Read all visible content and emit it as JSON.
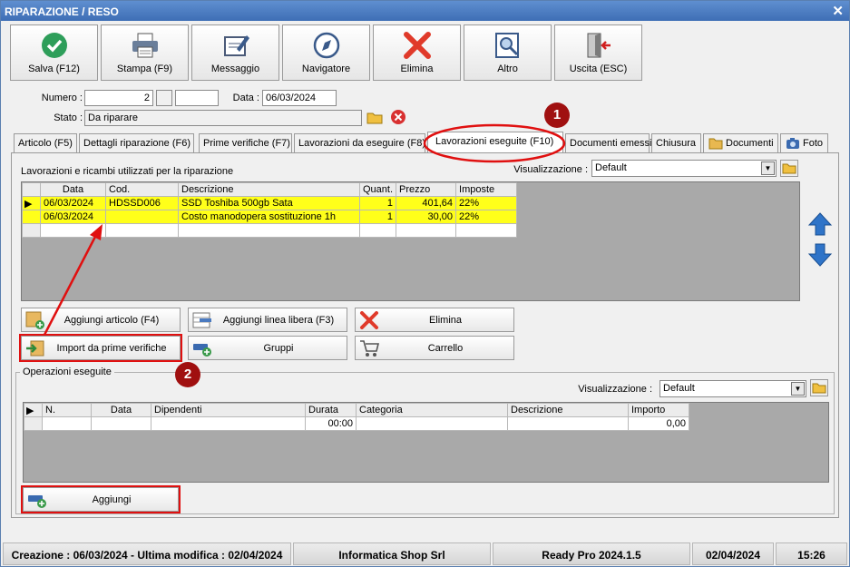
{
  "window": {
    "title": "RIPARAZIONE / RESO",
    "close_glyph": "✕"
  },
  "toolbar": [
    {
      "label": "Salva (F12)",
      "icon": "check-icon"
    },
    {
      "label": "Stampa (F9)",
      "icon": "printer-icon"
    },
    {
      "label": "Messaggio",
      "icon": "message-icon"
    },
    {
      "label": "Navigatore",
      "icon": "compass-icon"
    },
    {
      "label": "Elimina",
      "icon": "delete-x-icon"
    },
    {
      "label": "Altro",
      "icon": "magnifier-icon"
    },
    {
      "label": "Uscita (ESC)",
      "icon": "exit-door-icon"
    }
  ],
  "header": {
    "numero_label": "Numero :",
    "numero_value": "2",
    "data_label": "Data :",
    "data_value": "06/03/2024",
    "stato_label": "Stato :",
    "stato_value": "Da riparare"
  },
  "tabs": [
    {
      "label": "Articolo (F5)"
    },
    {
      "label": "Dettagli riparazione (F6)"
    },
    {
      "label": "Prime verifiche (F7)"
    },
    {
      "label": "Lavorazioni da eseguire (F8)"
    },
    {
      "label": "Lavorazioni eseguite  (F10)"
    },
    {
      "label": "Documenti emessi"
    },
    {
      "label": "Chiusura"
    },
    {
      "label": "Documenti"
    },
    {
      "label": "Foto"
    }
  ],
  "lavorazioni": {
    "section_label": "Lavorazioni e ricambi utilizzati per la riparazione",
    "view_label": "Visualizzazione :",
    "view_value": "Default",
    "columns": [
      "Data",
      "Cod.",
      "Descrizione",
      "Quant.",
      "Prezzo",
      "Imposte"
    ],
    "rows": [
      {
        "data": "06/03/2024",
        "cod": "HDSSD006",
        "descrizione": "SSD Toshiba 500gb Sata",
        "quant": "1",
        "prezzo": "401,64",
        "imposte": "22%"
      },
      {
        "data": "06/03/2024",
        "cod": "",
        "descrizione": "Costo manodopera sostituzione 1h",
        "quant": "1",
        "prezzo": "30,00",
        "imposte": "22%"
      }
    ],
    "buttons": {
      "aggiungi_articolo": "Aggiungi articolo (F4)",
      "aggiungi_linea": "Aggiungi linea libera (F3)",
      "elimina": "Elimina",
      "import_prime": "Import da prime verifiche",
      "gruppi": "Gruppi",
      "carrello": "Carrello"
    }
  },
  "operazioni": {
    "group_label": "Operazioni eseguite",
    "view_label": "Visualizzazione :",
    "view_value": "Default",
    "columns": [
      "N.",
      "Data",
      "Dipendenti",
      "Durata",
      "Categoria",
      "Descrizione",
      "Importo"
    ],
    "row": {
      "n": "",
      "data": "",
      "dipendenti": "",
      "durata": "00:00",
      "categoria": "",
      "descrizione": "",
      "importo": "0,00"
    },
    "aggiungi_label": "Aggiungi"
  },
  "markers": {
    "one": "1",
    "two": "2"
  },
  "statusbar": {
    "dates": "Creazione : 06/03/2024 - Ultima modifica : 02/04/2024",
    "company": "Informatica Shop Srl",
    "product": "Ready Pro 2024.1.5",
    "date": "02/04/2024",
    "time": "15:26"
  },
  "colors": {
    "highlight": "#ffff1a",
    "annotation": "#e01010",
    "marker": "#a01010",
    "titlebar": "#3e6eb5"
  }
}
